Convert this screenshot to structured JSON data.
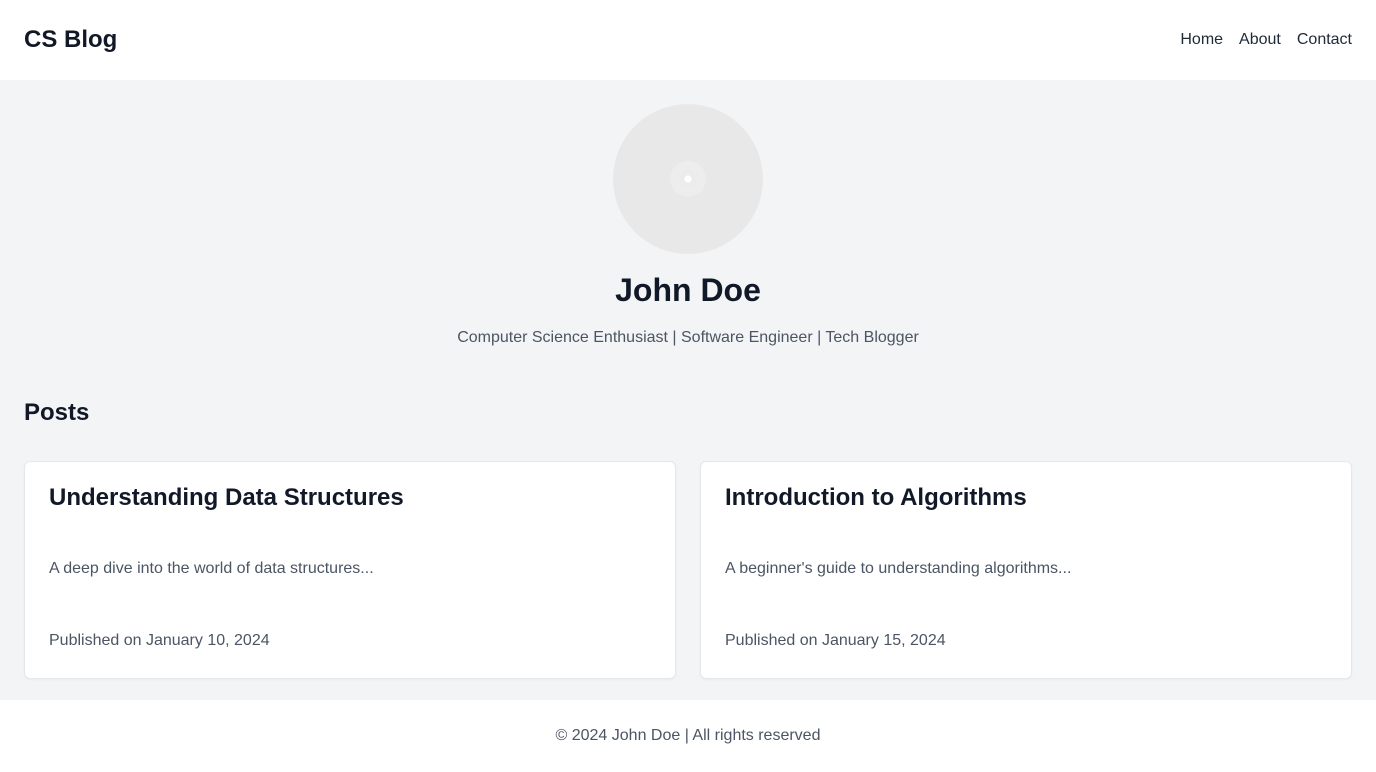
{
  "header": {
    "brand": "CS Blog",
    "nav": [
      {
        "label": "Home"
      },
      {
        "label": "About"
      },
      {
        "label": "Contact"
      }
    ]
  },
  "profile": {
    "avatar_icon": "image-loading-icon",
    "name": "John Doe",
    "bio": "Computer Science Enthusiast | Software Engineer | Tech Blogger"
  },
  "posts": {
    "heading": "Posts",
    "items": [
      {
        "title": "Understanding Data Structures",
        "excerpt": "A deep dive into the world of data structures...",
        "date": "Published on January 10, 2024"
      },
      {
        "title": "Introduction to Algorithms",
        "excerpt": "A beginner's guide to understanding algorithms...",
        "date": "Published on January 15, 2024"
      }
    ]
  },
  "footer": {
    "text": "© 2024 John Doe | All rights reserved"
  },
  "colors": {
    "page_background": "#f3f4f6",
    "surface": "#ffffff",
    "text_primary": "#111827",
    "text_secondary": "#4b5563"
  }
}
